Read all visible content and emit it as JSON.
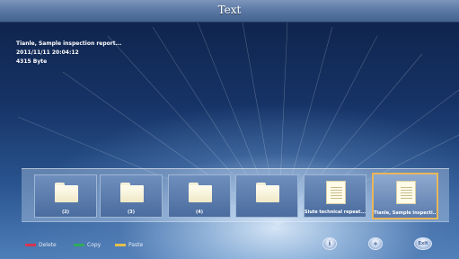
{
  "window": {
    "title": "Text"
  },
  "info": {
    "name": "Tianle, Sample inspection report...",
    "datetime": "2011/11/11 20:04:12",
    "size": "4315 Byte"
  },
  "thumbnails": [
    {
      "kind": "folder",
      "label": "(2)",
      "selected": false
    },
    {
      "kind": "folder",
      "label": "(3)",
      "selected": false
    },
    {
      "kind": "folder",
      "label": "(4)",
      "selected": false
    },
    {
      "kind": "folder",
      "label": "",
      "selected": false
    },
    {
      "kind": "document",
      "label": "Siute technical repeat...",
      "selected": false
    },
    {
      "kind": "document",
      "label": "Tianle, Sample inspecti...",
      "selected": true
    }
  ],
  "hints": [
    {
      "label": "Delete",
      "color": "#d8354f"
    },
    {
      "label": "Copy",
      "color": "#2faa5a"
    },
    {
      "label": "Paste",
      "color": "#e3c04a"
    }
  ],
  "buttons": [
    {
      "name": "info-button",
      "glyph": "i"
    },
    {
      "name": "add-button",
      "glyph": "+"
    },
    {
      "name": "exit-button",
      "glyph": "Exit"
    }
  ]
}
